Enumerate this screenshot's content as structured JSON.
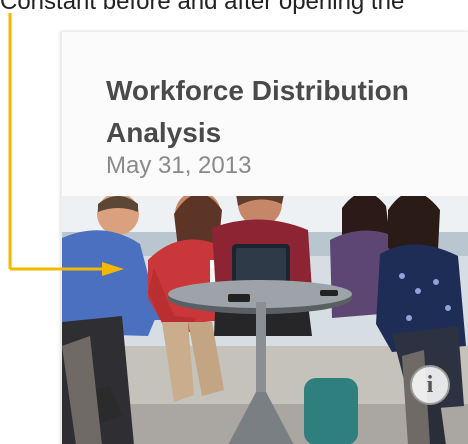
{
  "callout": {
    "text": "Constant before and after opening the",
    "color": "#f5b800"
  },
  "card": {
    "title": "Workforce Distribution Analysis",
    "date": "May 31, 2013",
    "info_icon": "info-icon",
    "info_label": "i"
  }
}
